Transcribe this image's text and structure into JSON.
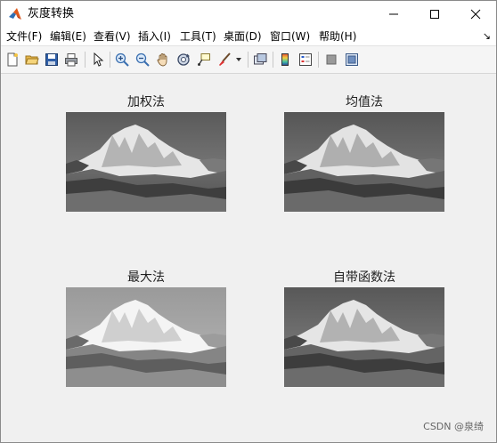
{
  "window": {
    "title": "灰度转换",
    "minimize": "minimize",
    "maximize": "maximize",
    "close": "close"
  },
  "menu": {
    "items": [
      {
        "label": "文件(F)"
      },
      {
        "label": "编辑(E)"
      },
      {
        "label": "查看(V)"
      },
      {
        "label": "插入(I)"
      },
      {
        "label": "工具(T)"
      },
      {
        "label": "桌面(D)"
      },
      {
        "label": "窗口(W)"
      },
      {
        "label": "帮助(H)"
      }
    ],
    "dock_arrow": "↘"
  },
  "toolbar": {
    "icons": [
      "new-figure-icon",
      "open-file-icon",
      "save-icon",
      "print-icon",
      "select-arrow-icon",
      "zoom-in-icon",
      "zoom-out-icon",
      "pan-hand-icon",
      "rotate-3d-icon",
      "data-cursor-icon",
      "brush-icon",
      "dropdown-arrow-icon",
      "link-plot-icon",
      "colorbar-icon",
      "legend-icon",
      "hide-plot-tools-icon",
      "show-plot-tools-icon"
    ]
  },
  "plots": [
    {
      "title": "加权法",
      "image": "grayscale mountain photo"
    },
    {
      "title": "均值法",
      "image": "grayscale mountain photo"
    },
    {
      "title": "最大法",
      "image": "grayscale mountain photo (brighter)"
    },
    {
      "title": "自带函数法",
      "image": "grayscale mountain photo"
    }
  ],
  "watermark": "CSDN @泉绮"
}
